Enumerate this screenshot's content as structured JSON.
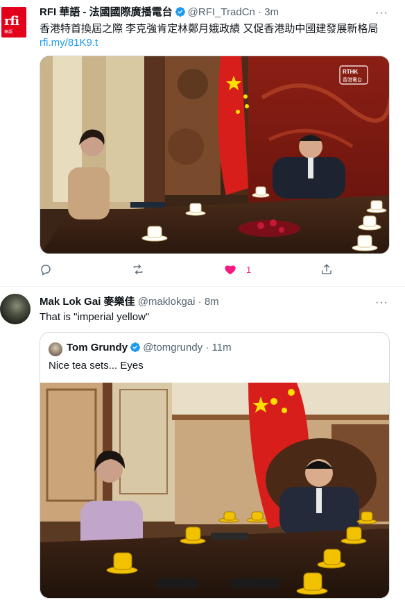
{
  "tweet1": {
    "author_name": "RFI 華語 - 法國國際廣播電台",
    "handle": "@RFI_TradCn",
    "separator": "·",
    "time": "3m",
    "more": "···",
    "text": "香港特首換屆之際 李克強肯定林鄭月娥政績 又促香港助中國建發展新格局",
    "link": "rfi.my/81K9.t",
    "avatar_logo": "rfi",
    "avatar_sub": "華語",
    "media_watermark_top": "RTHK",
    "media_watermark_bottom": "香港電台",
    "actions": {
      "reply_icon": "reply-icon",
      "retweet_icon": "retweet-icon",
      "like_icon": "heart-filled-icon",
      "like_count": "1",
      "share_icon": "share-icon"
    },
    "like_color": "#f91880"
  },
  "tweet2": {
    "author_name": "Mak Lok Gai 麥樂佳",
    "handle": "@maklokgai",
    "separator": "·",
    "time": "8m",
    "more": "···",
    "text": "That is \"imperial yellow\"",
    "quote": {
      "author_name": "Tom Grundy",
      "handle": "@tomgrundy",
      "separator": "·",
      "time": "11m",
      "text": "Nice tea sets... Eyes"
    }
  },
  "colors": {
    "accent": "#1d9bf0",
    "secondary_text": "#536471",
    "border": "#cfd9de",
    "rfi_red": "#e3001b"
  }
}
